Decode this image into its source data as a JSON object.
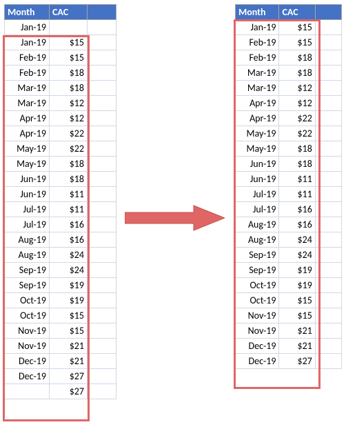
{
  "headers": {
    "month": "Month",
    "cac": "CAC"
  },
  "left_table": {
    "rows": [
      {
        "month": "Jan-19",
        "cac": ""
      },
      {
        "month": "Jan-19",
        "cac": "$15"
      },
      {
        "month": "Feb-19",
        "cac": "$15"
      },
      {
        "month": "Feb-19",
        "cac": "$18"
      },
      {
        "month": "Mar-19",
        "cac": "$18"
      },
      {
        "month": "Mar-19",
        "cac": "$12"
      },
      {
        "month": "Apr-19",
        "cac": "$12"
      },
      {
        "month": "Apr-19",
        "cac": "$22"
      },
      {
        "month": "May-19",
        "cac": "$22"
      },
      {
        "month": "May-19",
        "cac": "$18"
      },
      {
        "month": "Jun-19",
        "cac": "$18"
      },
      {
        "month": "Jun-19",
        "cac": "$11"
      },
      {
        "month": "Jul-19",
        "cac": "$11"
      },
      {
        "month": "Jul-19",
        "cac": "$16"
      },
      {
        "month": "Aug-19",
        "cac": "$16"
      },
      {
        "month": "Aug-19",
        "cac": "$24"
      },
      {
        "month": "Sep-19",
        "cac": "$24"
      },
      {
        "month": "Sep-19",
        "cac": "$19"
      },
      {
        "month": "Oct-19",
        "cac": "$19"
      },
      {
        "month": "Oct-19",
        "cac": "$15"
      },
      {
        "month": "Nov-19",
        "cac": "$15"
      },
      {
        "month": "Nov-19",
        "cac": "$21"
      },
      {
        "month": "Dec-19",
        "cac": "$21"
      },
      {
        "month": "Dec-19",
        "cac": "$27"
      },
      {
        "month": "",
        "cac": "$27"
      }
    ]
  },
  "right_table": {
    "rows": [
      {
        "month": "Jan-19",
        "cac": "$15"
      },
      {
        "month": "Feb-19",
        "cac": "$15"
      },
      {
        "month": "Feb-19",
        "cac": "$18"
      },
      {
        "month": "Mar-19",
        "cac": "$18"
      },
      {
        "month": "Mar-19",
        "cac": "$12"
      },
      {
        "month": "Apr-19",
        "cac": "$12"
      },
      {
        "month": "Apr-19",
        "cac": "$22"
      },
      {
        "month": "May-19",
        "cac": "$22"
      },
      {
        "month": "May-19",
        "cac": "$18"
      },
      {
        "month": "Jun-19",
        "cac": "$18"
      },
      {
        "month": "Jun-19",
        "cac": "$11"
      },
      {
        "month": "Jul-19",
        "cac": "$11"
      },
      {
        "month": "Jul-19",
        "cac": "$16"
      },
      {
        "month": "Aug-19",
        "cac": "$16"
      },
      {
        "month": "Aug-19",
        "cac": "$24"
      },
      {
        "month": "Sep-19",
        "cac": "$24"
      },
      {
        "month": "Sep-19",
        "cac": "$19"
      },
      {
        "month": "Oct-19",
        "cac": "$19"
      },
      {
        "month": "Oct-19",
        "cac": "$15"
      },
      {
        "month": "Nov-19",
        "cac": "$15"
      },
      {
        "month": "Nov-19",
        "cac": "$21"
      },
      {
        "month": "Dec-19",
        "cac": "$21"
      },
      {
        "month": "Dec-19",
        "cac": "$27"
      }
    ]
  },
  "colors": {
    "header_bg": "#4472c4",
    "highlight": "#e06666",
    "grid": "#d0d7e5"
  }
}
